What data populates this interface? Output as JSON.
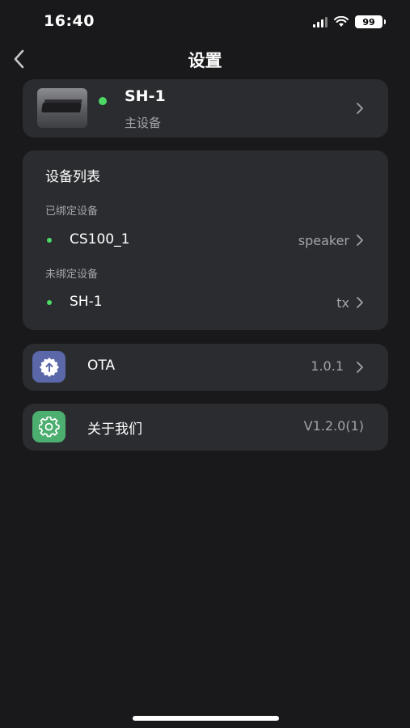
{
  "status_bar": {
    "time": "16:40",
    "battery": "99",
    "icons": [
      "cellular-signal-icon",
      "wifi-icon",
      "battery-icon"
    ]
  },
  "nav": {
    "title": "设置",
    "back_icon": "chevron-left-icon"
  },
  "main_device": {
    "name": "SH-1",
    "role": "主设备",
    "status_color": "#4cd964"
  },
  "device_list": {
    "title": "设备列表",
    "bound_label": "已绑定设备",
    "unbound_label": "未绑定设备",
    "bound": [
      {
        "name": "CS100_1",
        "type": "speaker"
      }
    ],
    "unbound": [
      {
        "name": "SH-1",
        "type": "tx"
      }
    ]
  },
  "menu": [
    {
      "label": "OTA",
      "value": "1.0.1",
      "icon": "upload-badge-icon",
      "icon_color": "#5a67a8"
    },
    {
      "label": "关于我们",
      "value": "V1.2.0(1)",
      "icon": "gear-icon",
      "icon_color": "#4cae6f"
    }
  ],
  "colors": {
    "background": "#19191b",
    "card": "#2b2c30",
    "secondary_text": "#a3a4a9",
    "online": "#4cd964"
  }
}
